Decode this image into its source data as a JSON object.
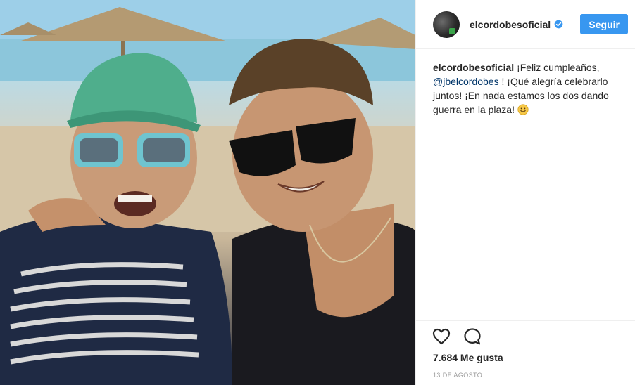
{
  "header": {
    "username": "elcordobesoficial",
    "follow_label": "Seguir"
  },
  "caption": {
    "username": "elcordobesoficial",
    "text_before_mention": "¡Feliz cumpleaños,",
    "mention": "@jbelcordobes",
    "text_after_mention": "! ¡Qué alegría celebrarlo juntos! ¡En nada estamos los dos dando guerra en la plaza!"
  },
  "stats": {
    "likes": "7.684 Me gusta",
    "date": "13 DE AGOSTO"
  },
  "icons": {
    "verified": "verified-badge-icon",
    "emoji": "smiling-face-emoji",
    "like": "heart-outline-icon",
    "comment": "comment-bubble-icon"
  },
  "colors": {
    "follow_button": "#3897f0",
    "verified": "#3897f0",
    "mention": "#003569",
    "date": "#999999",
    "border": "#efefef"
  }
}
